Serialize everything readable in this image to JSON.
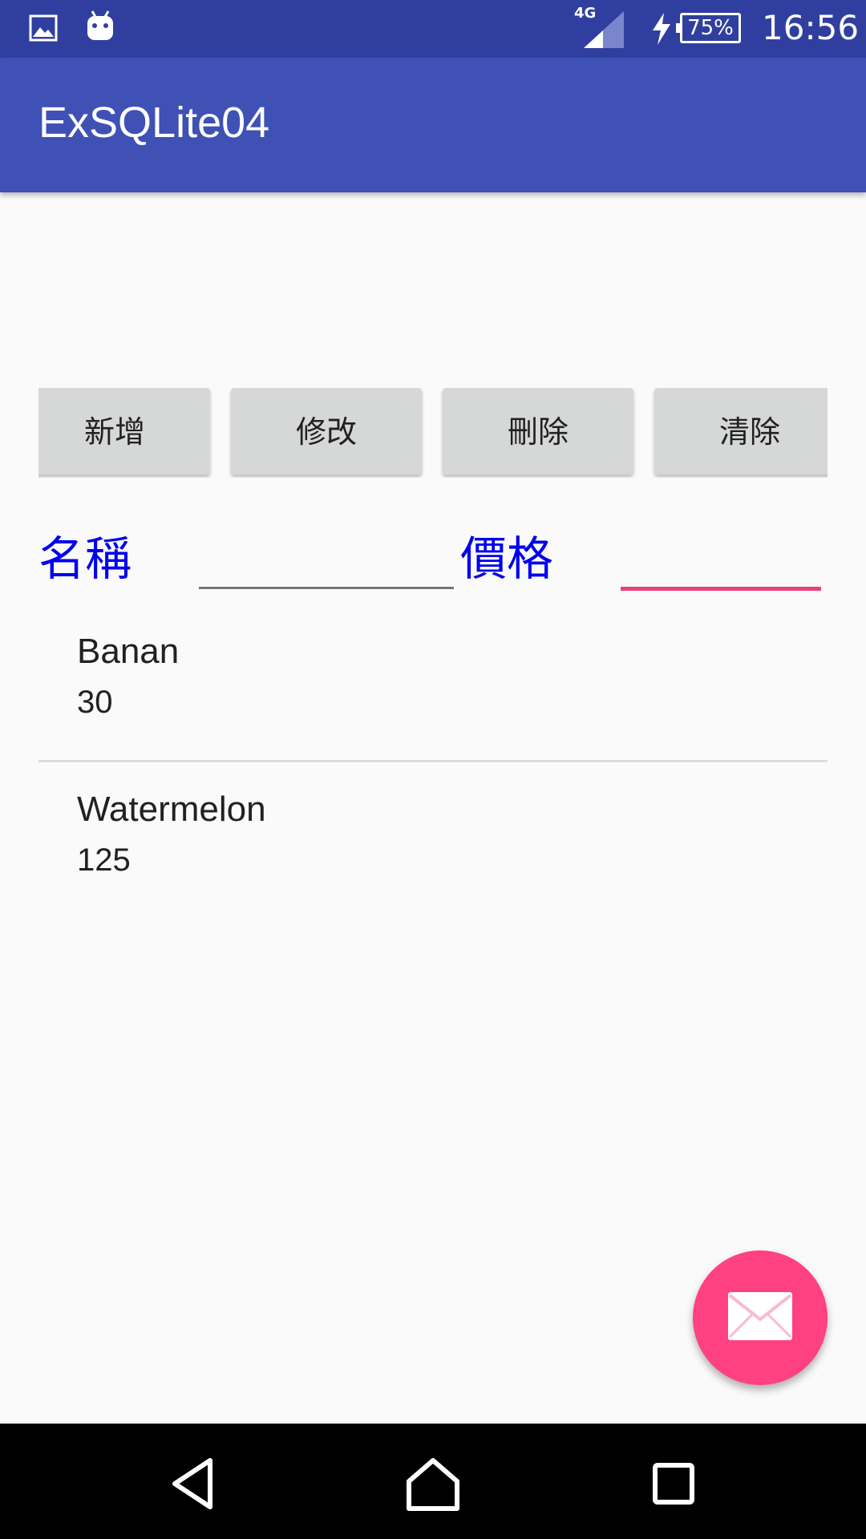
{
  "status_bar": {
    "network_type": "4G",
    "battery": "75%",
    "time": "16:56",
    "icons": [
      "gallery-icon",
      "android-icon",
      "signal-icon",
      "charging-icon",
      "battery-icon"
    ]
  },
  "app_bar": {
    "title": "ExSQLite04"
  },
  "buttons": {
    "add": "新增",
    "edit": "修改",
    "delete": "刪除",
    "clear": "清除"
  },
  "form": {
    "name_label": "名稱",
    "name_value": "",
    "price_label": "價格",
    "price_value": ""
  },
  "items": [
    {
      "name": "Banan",
      "price": "30"
    },
    {
      "name": "Watermelon",
      "price": "125"
    }
  ],
  "fab": {
    "icon": "mail-icon"
  },
  "colors": {
    "status_bar": "#303f9f",
    "app_bar": "#3f51b5",
    "accent": "#ff4081",
    "label_blue": "#0000ee"
  }
}
